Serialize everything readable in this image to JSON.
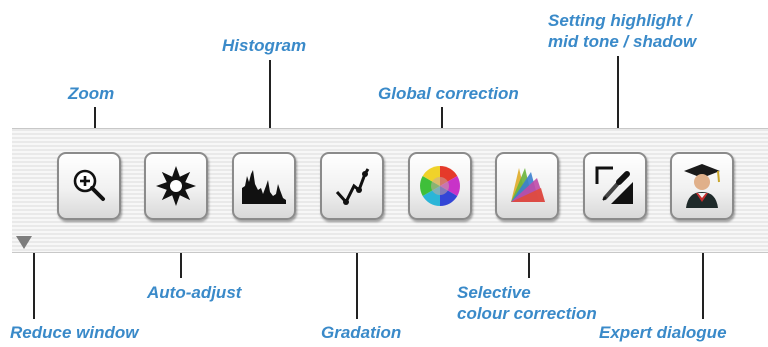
{
  "labels": {
    "zoom": "Zoom",
    "histogram": "Histogram",
    "global_correction": "Global correction",
    "setting_line1": "Setting highlight /",
    "setting_line2": "mid tone / shadow",
    "auto_adjust": "Auto-adjust",
    "selective_line1": "Selective",
    "selective_line2": "colour correction",
    "reduce_window": "Reduce window",
    "gradation": "Gradation",
    "expert_dialogue": "Expert dialogue"
  },
  "toolbar": {
    "buttons": [
      {
        "name": "zoom-button",
        "icon": "zoom-icon"
      },
      {
        "name": "auto-adjust-button",
        "icon": "aperture-icon"
      },
      {
        "name": "histogram-button",
        "icon": "histogram-icon"
      },
      {
        "name": "gradation-button",
        "icon": "gradation-curve-icon"
      },
      {
        "name": "global-correction-button",
        "icon": "color-wheel-icon"
      },
      {
        "name": "selective-colour-correction-button",
        "icon": "color-fan-icon"
      },
      {
        "name": "setting-highlight-button",
        "icon": "eyedropper-icon"
      },
      {
        "name": "expert-dialogue-button",
        "icon": "graduate-icon"
      }
    ]
  },
  "colors": {
    "callout_text": "#3a8ac9",
    "leader_line": "#222222",
    "button_border": "#8b8b8b"
  }
}
